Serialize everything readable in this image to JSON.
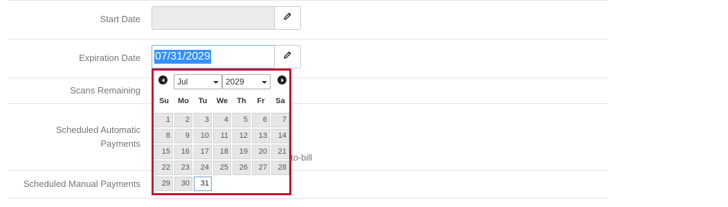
{
  "form": {
    "start_date_label": "Start Date",
    "start_date_value": "",
    "expiration_date_label": "Expiration Date",
    "expiration_date_value": "07/31/2029",
    "scans_remaining_label": "Scans Remaining",
    "scheduled_automatic_payments_label_line1": "Scheduled Automatic",
    "scheduled_automatic_payments_label_line2": "Payments",
    "scheduled_manual_payments_label": "Scheduled Manual Payments",
    "partial_text": "to-bill",
    "edit_icon": "pencil-icon"
  },
  "datepicker": {
    "prev_icon": "prev-arrow-icon",
    "next_icon": "next-arrow-icon",
    "month": "Jul",
    "year": "2029",
    "weekdays": [
      "Su",
      "Mo",
      "Tu",
      "We",
      "Th",
      "Fr",
      "Sa"
    ],
    "days": [
      "1",
      "2",
      "3",
      "4",
      "5",
      "6",
      "7",
      "8",
      "9",
      "10",
      "11",
      "12",
      "13",
      "14",
      "15",
      "16",
      "17",
      "18",
      "19",
      "20",
      "21",
      "22",
      "23",
      "24",
      "25",
      "26",
      "27",
      "28",
      "29",
      "30",
      "31"
    ],
    "first_weekday_index": 0,
    "selected_day": "31",
    "accent_color": "#c8102e"
  }
}
